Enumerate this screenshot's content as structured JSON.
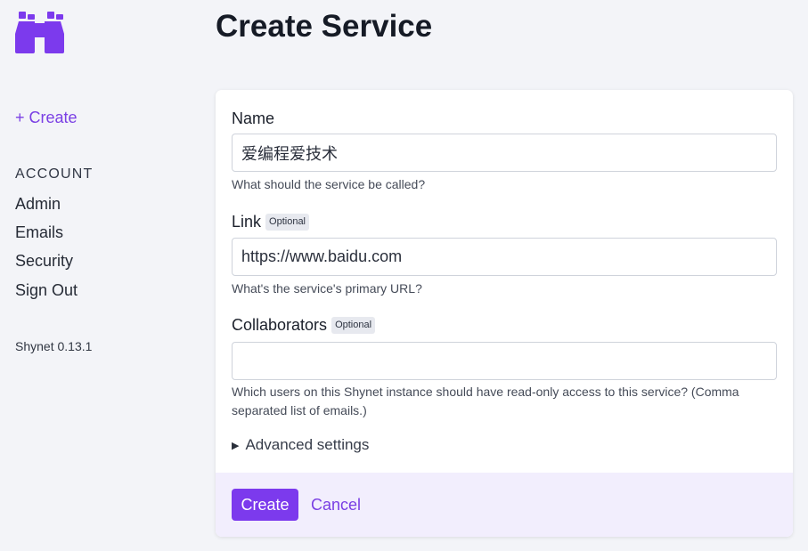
{
  "sidebar": {
    "create_label": "+ Create",
    "section_title": "ACCOUNT",
    "items": [
      {
        "label": "Admin"
      },
      {
        "label": "Emails"
      },
      {
        "label": "Security"
      },
      {
        "label": "Sign Out"
      }
    ],
    "version": "Shynet 0.13.1"
  },
  "page": {
    "title": "Create Service"
  },
  "form": {
    "name": {
      "label": "Name",
      "value": "爱编程爱技术",
      "help": "What should the service be called?"
    },
    "link": {
      "label": "Link",
      "badge": "Optional",
      "value": "https://www.baidu.com",
      "help": "What's the service's primary URL?"
    },
    "collaborators": {
      "label": "Collaborators",
      "badge": "Optional",
      "value": "",
      "help": "Which users on this Shynet instance should have read-only access to this service? (Comma separated list of emails.)"
    },
    "advanced_label": "Advanced settings",
    "create_button": "Create",
    "cancel_button": "Cancel"
  },
  "colors": {
    "accent": "#7c3aed",
    "link": "#7a3fe4",
    "background": "#f3f4f8",
    "footer": "#f2eefd"
  },
  "icons": {
    "logo": "binoculars-icon",
    "advanced_toggle": "triangle-right-icon"
  }
}
